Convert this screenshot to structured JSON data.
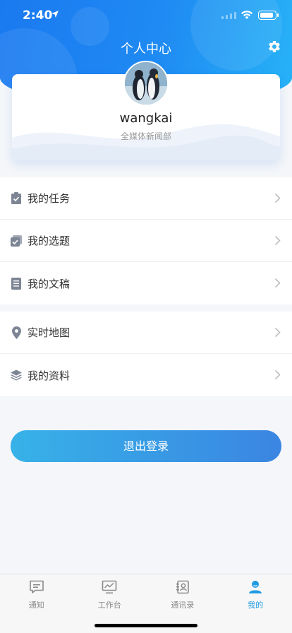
{
  "status_bar": {
    "time": "2:40",
    "battery_level": 0.9
  },
  "header": {
    "title": "个人中心",
    "settings_icon": "gear-icon"
  },
  "profile": {
    "name": "wangkai",
    "department": "全媒体新闻部",
    "avatar_icon": "penguins-avatar"
  },
  "menu_group_1": [
    {
      "label": "我的任务",
      "icon": "clipboard-check-icon"
    },
    {
      "label": "我的选题",
      "icon": "checkbox-stack-icon"
    },
    {
      "label": "我的文稿",
      "icon": "document-icon"
    }
  ],
  "menu_group_2": [
    {
      "label": "实时地图",
      "icon": "location-pin-icon"
    },
    {
      "label": "我的资料",
      "icon": "layers-icon"
    }
  ],
  "logout_label": "退出登录",
  "tab_bar": [
    {
      "label": "通知",
      "icon": "chat-bubble-icon",
      "active": false
    },
    {
      "label": "工作台",
      "icon": "monitor-chart-icon",
      "active": false
    },
    {
      "label": "通讯录",
      "icon": "contacts-book-icon",
      "active": false
    },
    {
      "label": "我的",
      "icon": "user-icon",
      "active": true
    }
  ],
  "colors": {
    "accent": "#1e9be0",
    "header_start": "#1a79f0",
    "header_end": "#27b3f7",
    "button_start": "#37b2e8",
    "button_end": "#3a85e2",
    "icon_gray": "#7d8595"
  }
}
